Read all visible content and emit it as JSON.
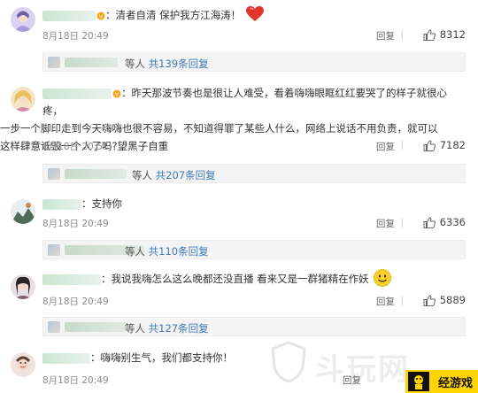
{
  "comments": [
    {
      "text": "：清者自清 保护我方江海涛！",
      "time": "8月18日 20:49",
      "reply_label": "回复",
      "likes": "8312",
      "emoji": "heart"
    },
    {
      "text_line1": "：昨天那波节奏也是很让人难受，看着嗨嗨眼眶红红要哭了的样子就很心疼，",
      "text_line2": "一步一个脚印走到今天嗨嗨也很不容易，不知道得罪了某些人什么，网络上说话不用负责，就可以",
      "text_line3": "这样肆意诋毁一个人了吗?望黑子自重",
      "time": "8月18日 20:51",
      "reply_label": "回复",
      "likes": "7182"
    },
    {
      "text": "：支持你",
      "time": "8月18日 20:49",
      "reply_label": "回复",
      "likes": "6336"
    },
    {
      "text": "：我说我嗨怎么这么晚都还没直播 看来又是一群猪精在作妖",
      "time": "8月18日 20:49",
      "reply_label": "回复",
      "likes": "5889",
      "emoji": "smile"
    },
    {
      "text": "：嗨嗨别生气，我们都支持你！",
      "time": "8月18日 20:49",
      "reply_label": "回复",
      "likes": ""
    }
  ],
  "reply_threads": [
    {
      "prefix": "等人 ",
      "count_text": "共139条回复"
    },
    {
      "prefix": "等人 ",
      "count_text": "共207条回复"
    },
    {
      "prefix": "等人 ",
      "count_text": "共110条回复"
    },
    {
      "prefix": "等人 ",
      "count_text": "共127条回复"
    }
  ],
  "watermark": "斗玩网",
  "brand": {
    "label": "经游戏"
  },
  "colors": {
    "link": "#3d7bb8",
    "reply_bg": "#f4f4f4",
    "brand_bg": "#ffd400",
    "heart": "#e0362a",
    "verified": "#f2a51b"
  },
  "icons": [
    "verified-badge-icon",
    "thumbs-up-icon",
    "heart-emoji-icon",
    "smile-emoji-icon"
  ]
}
